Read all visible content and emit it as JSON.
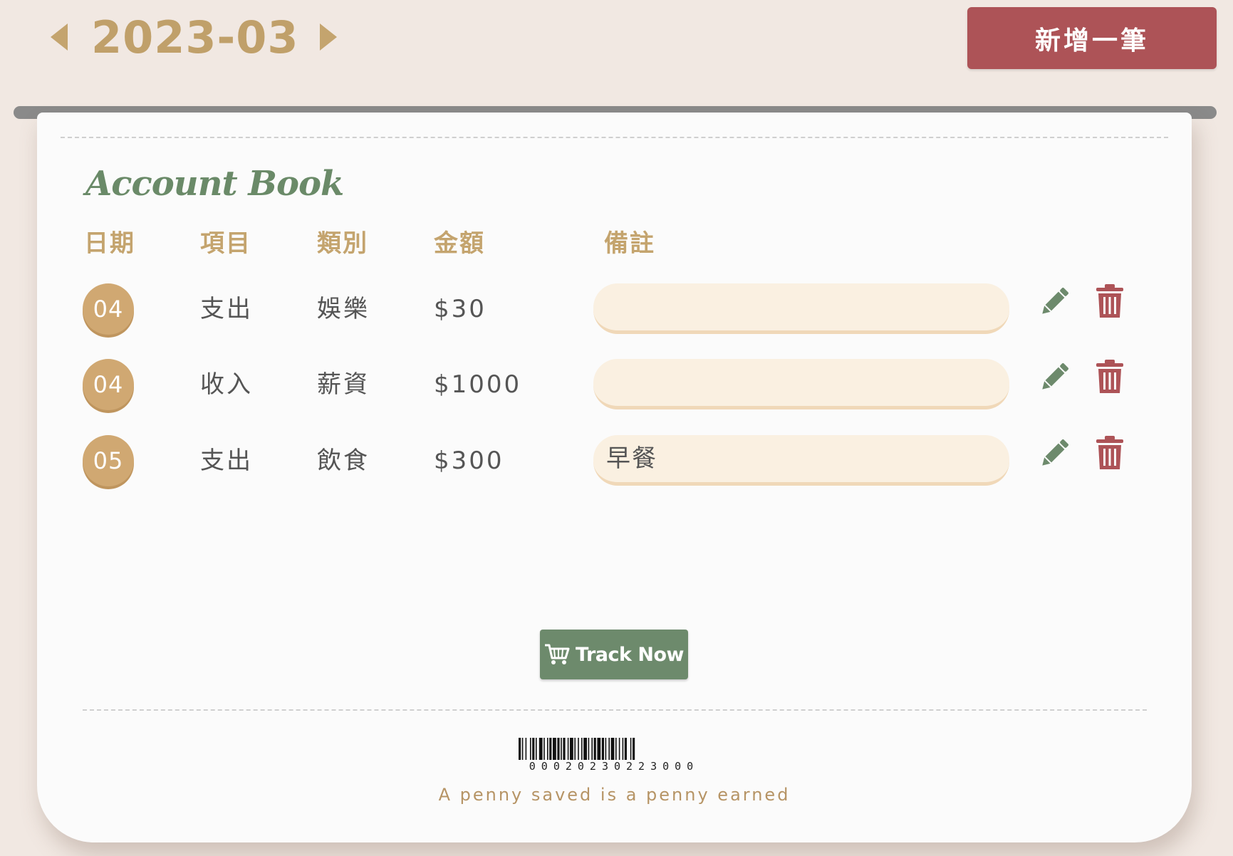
{
  "header": {
    "month": "2023-03",
    "add_label": "新增一筆"
  },
  "card": {
    "title": "Account Book",
    "columns": {
      "date": "日期",
      "item": "項目",
      "category": "類別",
      "amount": "金額",
      "note": "備註"
    },
    "rows": [
      {
        "date": "04",
        "item": "支出",
        "category": "娛樂",
        "amount": "$30",
        "note": ""
      },
      {
        "date": "04",
        "item": "收入",
        "category": "薪資",
        "amount": "$1000",
        "note": ""
      },
      {
        "date": "05",
        "item": "支出",
        "category": "飲食",
        "amount": "$300",
        "note": "早餐"
      }
    ],
    "row_icons": {
      "edit": "pencil-icon",
      "delete": "trash-icon"
    },
    "track_button": {
      "icon": "cart-icon",
      "label": "Track Now"
    },
    "barcode_number": "00020230223000",
    "quote": "A penny saved is a penny earned"
  },
  "colors": {
    "background": "#f1e8e2",
    "gold": "#c4a46e",
    "green": "#6d8a6c",
    "red": "#ad5357",
    "note_fill": "#faf0e1"
  }
}
